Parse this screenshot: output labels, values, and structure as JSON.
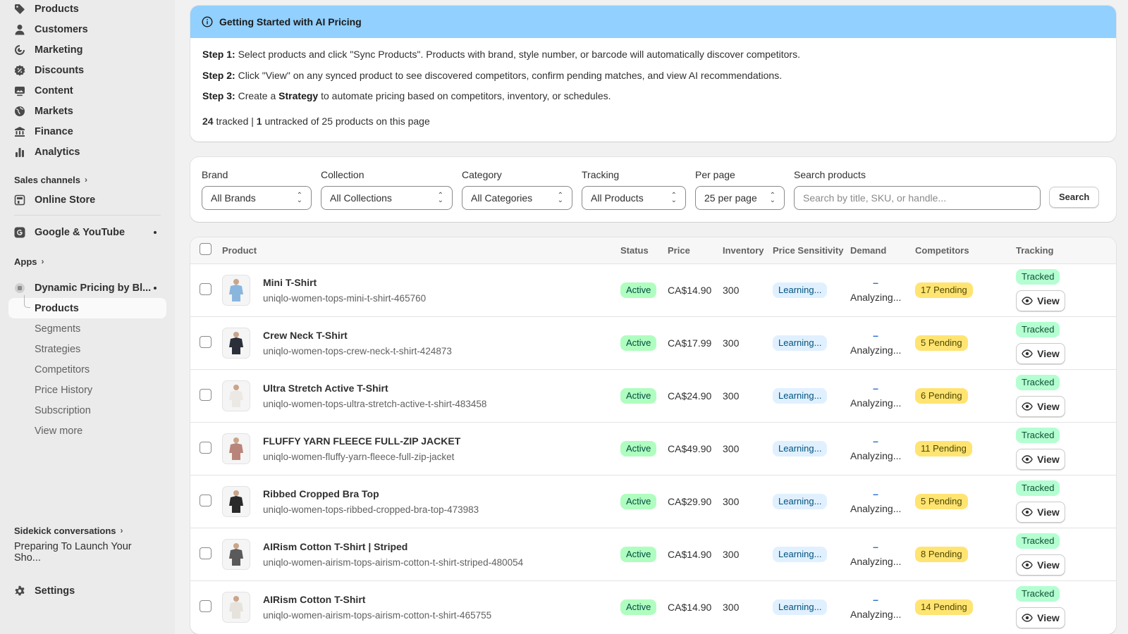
{
  "sidebar": {
    "nav": [
      {
        "label": "Products",
        "icon": "tag-icon"
      },
      {
        "label": "Customers",
        "icon": "person-icon"
      },
      {
        "label": "Marketing",
        "icon": "target-icon"
      },
      {
        "label": "Discounts",
        "icon": "discount-icon"
      },
      {
        "label": "Content",
        "icon": "image-icon"
      },
      {
        "label": "Markets",
        "icon": "globe-icon"
      },
      {
        "label": "Finance",
        "icon": "bank-icon"
      },
      {
        "label": "Analytics",
        "icon": "bar-chart-icon"
      }
    ],
    "sales_channels_label": "Sales channels",
    "online_store": "Online Store",
    "google_youtube": "Google & YouTube",
    "apps_label": "Apps",
    "app_name": "Dynamic Pricing by Bl...",
    "app_sub": [
      "Products",
      "Segments",
      "Strategies",
      "Competitors",
      "Price History",
      "Subscription",
      "View more"
    ],
    "sidekick_label": "Sidekick conversations",
    "sidekick_item": "Preparing To Launch Your Sho...",
    "settings": "Settings"
  },
  "banner": {
    "title": "Getting Started with AI Pricing",
    "step1_label": "Step 1:",
    "step1_text": " Select products and click \"Sync Products\". Products with brand, style number, or barcode will automatically discover competitors.",
    "step2_label": "Step 2:",
    "step2_text": " Click \"View\" on any synced product to see discovered competitors, confirm pending matches, and view AI recommendations.",
    "step3_label": "Step 3:",
    "step3_pre": " Create a ",
    "step3_bold": "Strategy",
    "step3_post": " to automate pricing based on competitors, inventory, or schedules.",
    "tracked_count": "24",
    "tracked_text": " tracked | ",
    "untracked_count": "1",
    "untracked_text": " untracked of 25 products on this page"
  },
  "filters": {
    "brand": {
      "label": "Brand",
      "value": "All Brands"
    },
    "collection": {
      "label": "Collection",
      "value": "All Collections"
    },
    "category": {
      "label": "Category",
      "value": "All Categories"
    },
    "tracking": {
      "label": "Tracking",
      "value": "All Products"
    },
    "per_page": {
      "label": "Per page",
      "value": "25 per page"
    },
    "search": {
      "label": "Search products",
      "placeholder": "Search by title, SKU, or handle..."
    },
    "search_button": "Search"
  },
  "table": {
    "headers": {
      "product": "Product",
      "status": "Status",
      "price": "Price",
      "inventory": "Inventory",
      "sensitivity": "Price Sensitivity",
      "demand": "Demand",
      "competitors": "Competitors",
      "tracking": "Tracking"
    },
    "rows": [
      {
        "title": "Mini T-Shirt",
        "handle": "uniqlo-women-tops-mini-t-shirt-465760",
        "status": "Active",
        "price": "CA$14.90",
        "inventory": "300",
        "sensitivity": "Learning...",
        "demand_dash": "–",
        "demand": "Analyzing...",
        "competitors": "17 Pending",
        "tracking": "Tracked",
        "view": "View",
        "thumb_color": "#8ab6de"
      },
      {
        "title": "Crew Neck T-Shirt",
        "handle": "uniqlo-women-tops-crew-neck-t-shirt-424873",
        "status": "Active",
        "price": "CA$17.99",
        "inventory": "300",
        "sensitivity": "Learning...",
        "demand_dash": "–",
        "demand": "Analyzing...",
        "competitors": "5 Pending",
        "tracking": "Tracked",
        "view": "View",
        "thumb_color": "#2b2f3a"
      },
      {
        "title": "Ultra Stretch Active T-Shirt",
        "handle": "uniqlo-women-tops-ultra-stretch-active-t-shirt-483458",
        "status": "Active",
        "price": "CA$24.90",
        "inventory": "300",
        "sensitivity": "Learning...",
        "demand_dash": "–",
        "demand": "Analyzing...",
        "competitors": "6 Pending",
        "tracking": "Tracked",
        "view": "View",
        "thumb_color": "#ece8e4"
      },
      {
        "title": "FLUFFY YARN FLEECE FULL-ZIP JACKET",
        "handle": "uniqlo-women-fluffy-yarn-fleece-full-zip-jacket",
        "status": "Active",
        "price": "CA$49.90",
        "inventory": "300",
        "sensitivity": "Learning...",
        "demand_dash": "–",
        "demand": "Analyzing...",
        "competitors": "11 Pending",
        "tracking": "Tracked",
        "view": "View",
        "thumb_color": "#b9857a"
      },
      {
        "title": "Ribbed Cropped Bra Top",
        "handle": "uniqlo-women-tops-ribbed-cropped-bra-top-473983",
        "status": "Active",
        "price": "CA$29.90",
        "inventory": "300",
        "sensitivity": "Learning...",
        "demand_dash": "–",
        "demand": "Analyzing...",
        "competitors": "5 Pending",
        "tracking": "Tracked",
        "view": "View",
        "thumb_color": "#2a2a2a"
      },
      {
        "title": "AIRism Cotton T-Shirt | Striped",
        "handle": "uniqlo-women-airism-tops-airism-cotton-t-shirt-striped-480054",
        "status": "Active",
        "price": "CA$14.90",
        "inventory": "300",
        "sensitivity": "Learning...",
        "demand_dash": "–",
        "demand": "Analyzing...",
        "competitors": "8 Pending",
        "tracking": "Tracked",
        "view": "View",
        "thumb_color": "#5a5a5a"
      },
      {
        "title": "AIRism Cotton T-Shirt",
        "handle": "uniqlo-women-airism-tops-airism-cotton-t-shirt-465755",
        "status": "Active",
        "price": "CA$14.90",
        "inventory": "300",
        "sensitivity": "Learning...",
        "demand_dash": "–",
        "demand": "Analyzing...",
        "competitors": "14 Pending",
        "tracking": "Tracked",
        "view": "View",
        "thumb_color": "#e6e2dc"
      }
    ]
  }
}
